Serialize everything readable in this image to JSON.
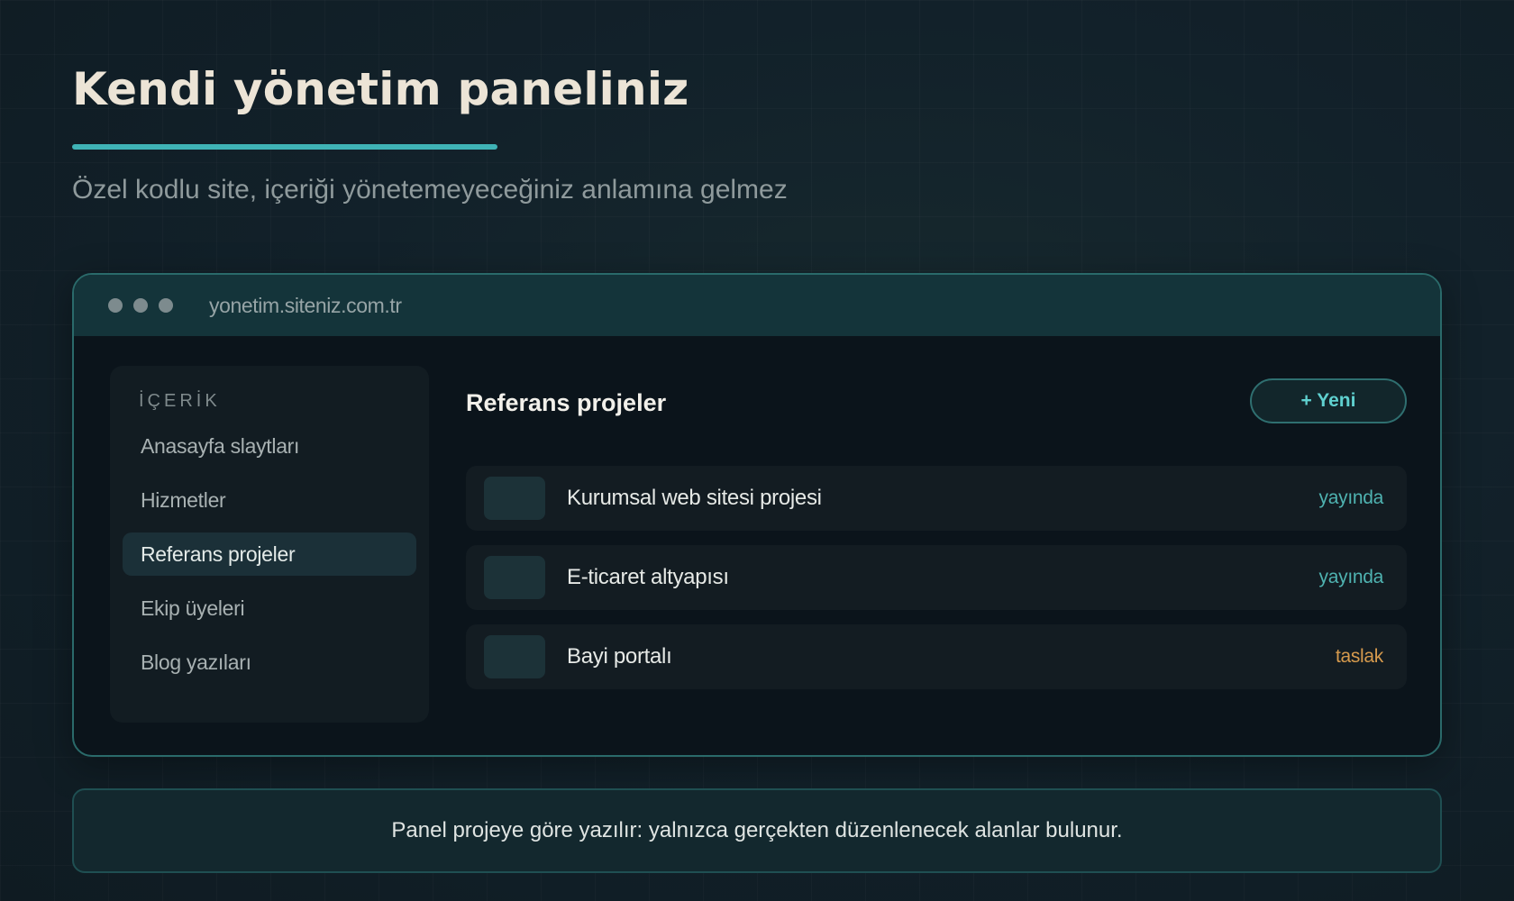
{
  "page": {
    "title": "Kendi yönetim paneliniz",
    "subtitle": "Özel kodlu site, içeriği yönetemeyeceğiniz anlamına gelmez"
  },
  "browser": {
    "url": "yonetim.siteniz.com.tr"
  },
  "sidebar": {
    "heading": "İÇERİK",
    "items": [
      {
        "label": "Anasayfa slaytları",
        "active": false
      },
      {
        "label": "Hizmetler",
        "active": false
      },
      {
        "label": "Referans projeler",
        "active": true
      },
      {
        "label": "Ekip üyeleri",
        "active": false
      },
      {
        "label": "Blog yazıları",
        "active": false
      }
    ]
  },
  "main": {
    "title": "Referans projeler",
    "new_button": "+ Yeni",
    "rows": [
      {
        "title": "Kurumsal web sitesi projesi",
        "status": "yayında"
      },
      {
        "title": "E-ticaret altyapısı",
        "status": "yayında"
      },
      {
        "title": "Bayi portalı",
        "status": "taslak"
      }
    ]
  },
  "note": "Panel projeye göre yazılır: yalnızca gerçekten düzenlenecek alanlar bulunur.",
  "colors": {
    "accent": "#3fb3b6",
    "published": "#4fb3b1",
    "draft": "#d69a4d",
    "background": "#12212a"
  }
}
